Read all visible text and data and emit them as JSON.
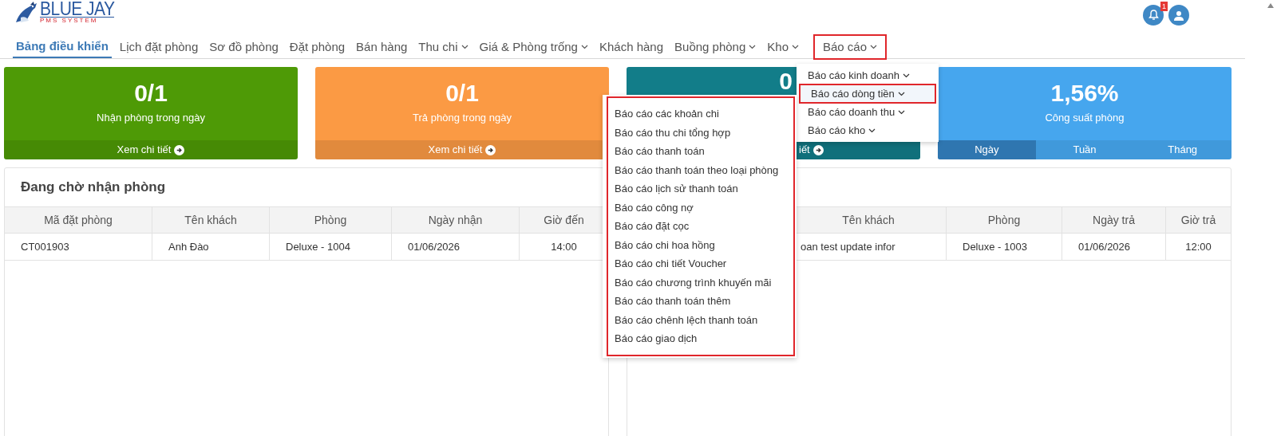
{
  "logo": {
    "title": "BLUE JAY",
    "subtitle": "PMS SYSTEM"
  },
  "nav": [
    {
      "label": "Bảng điều khiển",
      "selected": true,
      "caret": false,
      "highlighted": false
    },
    {
      "label": "Lịch đặt phòng",
      "selected": false,
      "caret": false,
      "highlighted": false
    },
    {
      "label": "Sơ đồ phòng",
      "selected": false,
      "caret": false,
      "highlighted": false
    },
    {
      "label": "Đặt phòng",
      "selected": false,
      "caret": false,
      "highlighted": false
    },
    {
      "label": "Bán hàng",
      "selected": false,
      "caret": false,
      "highlighted": false
    },
    {
      "label": "Thu chi",
      "selected": false,
      "caret": true,
      "highlighted": false
    },
    {
      "label": "Giá & Phòng trống",
      "selected": false,
      "caret": true,
      "highlighted": false
    },
    {
      "label": "Khách hàng",
      "selected": false,
      "caret": false,
      "highlighted": false
    },
    {
      "label": "Buồng phòng",
      "selected": false,
      "caret": true,
      "highlighted": false
    },
    {
      "label": "Kho",
      "selected": false,
      "caret": true,
      "highlighted": false
    },
    {
      "label": "Báo cáo",
      "selected": false,
      "caret": true,
      "highlighted": true
    }
  ],
  "notifications": {
    "badge": "1"
  },
  "cards": [
    {
      "value": "0/1",
      "label": "Nhận phòng trong ngày",
      "footer": "Xem chi tiết",
      "color": "#4e9a06"
    },
    {
      "value": "0/1",
      "label": "Trả phòng trong ngày",
      "footer": "Xem chi tiết",
      "color": "#fb9a44"
    },
    {
      "value": "0",
      "footer": "iết",
      "color": "#127d89",
      "kind": "covered"
    },
    {
      "value": "1,56%",
      "label": "Công suất phòng",
      "color": "#46a6ee",
      "tabs": [
        {
          "label": "Ngày",
          "selected": true
        },
        {
          "label": "Tuần",
          "selected": false
        },
        {
          "label": "Tháng",
          "selected": false
        }
      ]
    }
  ],
  "panels": [
    {
      "title": "Đang chờ nhận phòng",
      "columns": [
        "Mã đặt phòng",
        "Tên khách",
        "Phòng",
        "Ngày nhận",
        "Giờ đến"
      ],
      "rows": [
        [
          "CT001903",
          "Anh Đào",
          "Deluxe - 1004",
          "01/06/2026",
          "14:00"
        ]
      ]
    },
    {
      "columns": [
        "",
        "Tên khách",
        "Phòng",
        "Ngày trả",
        "Giờ trả"
      ],
      "rows": [
        [
          "",
          "oan test update infor",
          "Deluxe - 1003",
          "01/06/2026",
          "12:00"
        ]
      ]
    }
  ],
  "report_menu": [
    {
      "label": "Báo cáo kinh doanh",
      "highlighted": false
    },
    {
      "label": "Báo cáo dòng tiền",
      "highlighted": true
    },
    {
      "label": "Báo cáo doanh thu",
      "highlighted": false
    },
    {
      "label": "Báo cáo kho",
      "highlighted": false
    }
  ],
  "cashflow_menu": [
    "Báo cáo các khoản chi",
    "Báo cáo thu chi tổng hợp",
    "Báo cáo thanh toán",
    "Báo cáo thanh toán theo loại phòng",
    "Báo cáo lịch sử thanh toán",
    "Báo cáo công nợ",
    "Báo cáo đặt cọc",
    "Báo cáo chi hoa hồng",
    "Báo cáo chi tiết Voucher",
    "Báo cáo chương trình khuyến mãi",
    "Báo cáo thanh toán thêm",
    "Báo cáo chênh lệch thanh toán",
    "Báo cáo giao dịch"
  ]
}
